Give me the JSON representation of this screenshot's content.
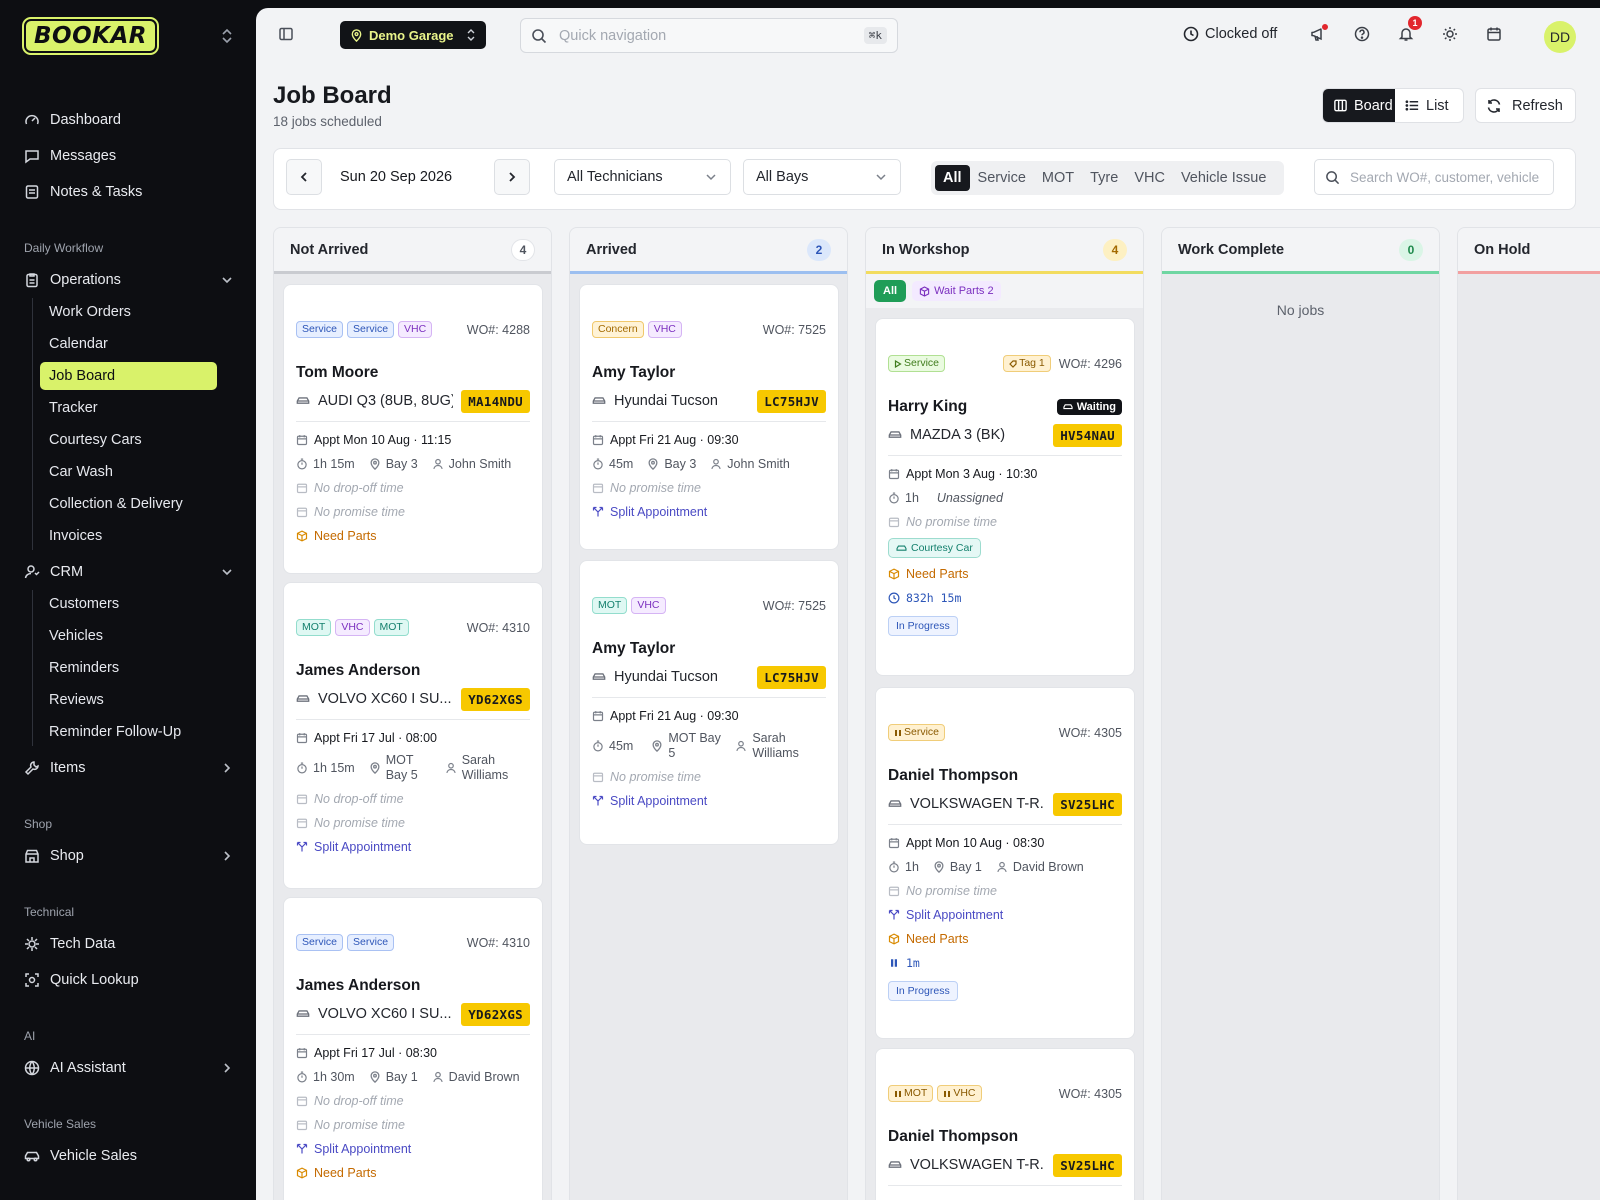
{
  "app": {
    "logo": "BOOKAR"
  },
  "sidebar": {
    "top": [
      {
        "label": "Dashboard",
        "icon": "gauge-icon"
      },
      {
        "label": "Messages",
        "icon": "message-icon"
      },
      {
        "label": "Notes & Tasks",
        "icon": "notes-icon"
      }
    ],
    "sections": {
      "daily": "Daily Workflow",
      "shop": "Shop",
      "technical": "Technical",
      "ai": "AI",
      "vehicle_sales": "Vehicle Sales"
    },
    "operations": {
      "label": "Operations",
      "items": [
        "Work Orders",
        "Calendar",
        "Job Board",
        "Tracker",
        "Courtesy Cars",
        "Car Wash",
        "Collection & Delivery",
        "Invoices"
      ]
    },
    "crm": {
      "label": "CRM",
      "items": [
        "Customers",
        "Vehicles",
        "Reminders",
        "Reviews",
        "Reminder Follow-Up"
      ]
    },
    "items": {
      "label": "Items"
    },
    "shop": {
      "label": "Shop"
    },
    "tech_data": {
      "label": "Tech Data"
    },
    "quick_lookup": {
      "label": "Quick Lookup"
    },
    "ai_assistant": {
      "label": "AI Assistant"
    },
    "vehicle_sales": {
      "label": "Vehicle Sales"
    }
  },
  "topbar": {
    "garage": "Demo Garage",
    "quick_nav_placeholder": "Quick navigation",
    "shortcut": "⌘k",
    "clock_status": "Clocked off",
    "notification_count": "1",
    "avatar_initials": "DD"
  },
  "page": {
    "title": "Job Board",
    "subtitle": "18 jobs scheduled",
    "view_board": "Board",
    "view_list": "List",
    "refresh": "Refresh"
  },
  "filters": {
    "date": "Sun 20 Sep 2026",
    "technicians": "All Technicians",
    "bays": "All Bays",
    "types": [
      "All",
      "Service",
      "MOT",
      "Tyre",
      "VHC",
      "Vehicle Issue"
    ],
    "search_placeholder": "Search WO#, customer, vehicle"
  },
  "columns": {
    "not_arrived": {
      "title": "Not Arrived",
      "count": "4"
    },
    "arrived": {
      "title": "Arrived",
      "count": "2"
    },
    "in_workshop": {
      "title": "In Workshop",
      "count": "4",
      "chip_all": "All",
      "chip_wait": "Wait Parts 2"
    },
    "work_complete": {
      "title": "Work Complete",
      "count": "0",
      "empty": "No jobs"
    },
    "on_hold": {
      "title": "On Hold"
    }
  },
  "labels": {
    "no_dropoff": "No drop-off time",
    "no_promise": "No promise time",
    "split": "Split Appointment",
    "need_parts": "Need Parts",
    "unassigned": "Unassigned",
    "waiting": "Waiting",
    "courtesy": "Courtesy Car",
    "in_progress": "In Progress"
  },
  "cards": {
    "na1": {
      "tags": [
        "Service",
        "Service",
        "VHC"
      ],
      "wo": "WO#: 4288",
      "customer": "Tom Moore",
      "vehicle": "AUDI Q3 (8UB, 8UG)",
      "plate": "MA14NDU",
      "appt": "Appt Mon 10 Aug · 11:15",
      "duration": "1h 15m",
      "bay": "Bay 3",
      "tech": "John Smith"
    },
    "na2": {
      "tags": [
        "MOT",
        "VHC",
        "MOT"
      ],
      "wo": "WO#: 4310",
      "customer": "James Anderson",
      "vehicle": "VOLVO XC60 I SU...",
      "plate": "YD62XGS",
      "appt": "Appt Fri 17 Jul · 08:00",
      "duration": "1h 15m",
      "bay": "MOT Bay 5",
      "tech": "Sarah Williams"
    },
    "na3": {
      "tags": [
        "Service",
        "Service"
      ],
      "wo": "WO#: 4310",
      "customer": "James Anderson",
      "vehicle": "VOLVO XC60 I SU...",
      "plate": "YD62XGS",
      "appt": "Appt Fri 17 Jul · 08:30",
      "duration": "1h 30m",
      "bay": "Bay 1",
      "tech": "David Brown"
    },
    "ar1": {
      "tags": [
        "Concern",
        "VHC"
      ],
      "wo": "WO#: 7525",
      "customer": "Amy Taylor",
      "vehicle": "Hyundai Tucson",
      "plate": "LC75HJV",
      "appt": "Appt Fri 21 Aug · 09:30",
      "duration": "45m",
      "bay": "Bay 3",
      "tech": "John Smith"
    },
    "ar2": {
      "tags": [
        "MOT",
        "VHC"
      ],
      "wo": "WO#: 7525",
      "customer": "Amy Taylor",
      "vehicle": "Hyundai Tucson",
      "plate": "LC75HJV",
      "appt": "Appt Fri 21 Aug · 09:30",
      "duration": "45m",
      "bay": "MOT Bay 5",
      "tech": "Sarah Williams"
    },
    "iw1": {
      "tags": [
        "Service"
      ],
      "tag_extra": "Tag 1",
      "wo": "WO#: 4296",
      "customer": "Harry King",
      "vehicle": "MAZDA 3 (BK)",
      "plate": "HV54NAU",
      "appt": "Appt Mon 3 Aug · 10:30",
      "duration": "1h",
      "timer": "832h 15m"
    },
    "iw2": {
      "tags": [
        "Service"
      ],
      "wo": "WO#: 4305",
      "customer": "Daniel Thompson",
      "vehicle": "VOLKSWAGEN T-R...",
      "plate": "SV25LHC",
      "appt": "Appt Mon 10 Aug · 08:30",
      "duration": "1h",
      "bay": "Bay 1",
      "tech": "David Brown",
      "timer": "1m"
    },
    "iw3": {
      "tags": [
        "MOT",
        "VHC"
      ],
      "wo": "WO#: 4305",
      "customer": "Daniel Thompson",
      "vehicle": "VOLKSWAGEN T-R...",
      "plate": "SV25LHC"
    }
  }
}
